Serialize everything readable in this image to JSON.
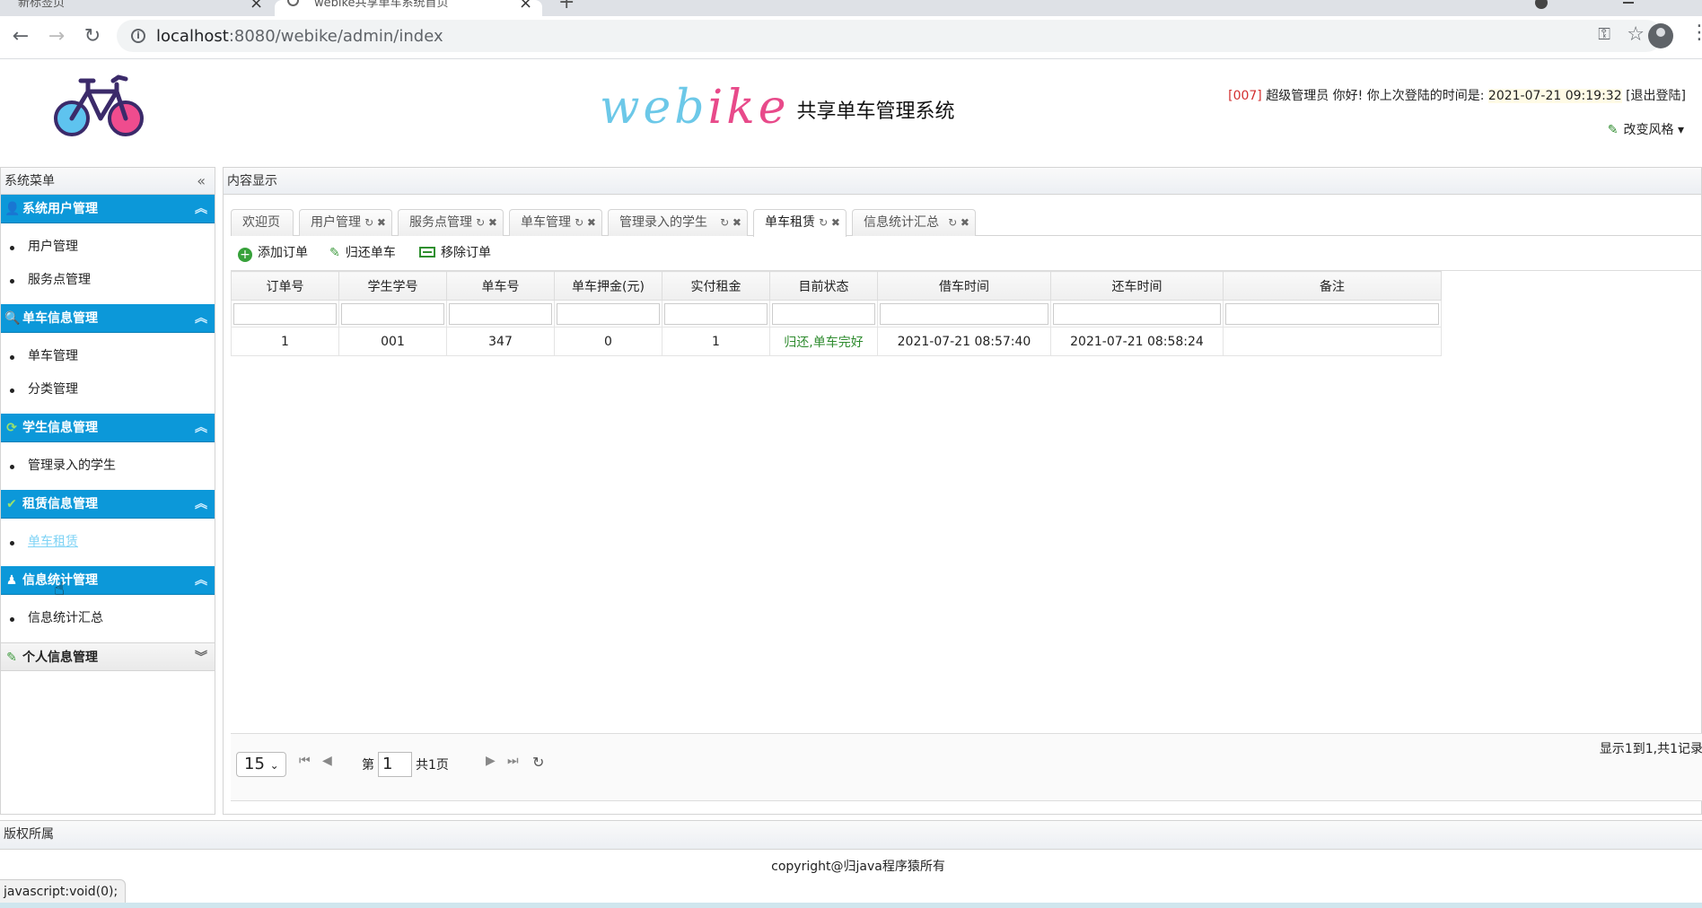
{
  "browser": {
    "tab1_title": "新标签页",
    "tab2_title": "webike共享单车系统首页",
    "url_host": "localhost",
    "url_rest": ":8080/webike/admin/index"
  },
  "header": {
    "brand_web": "web",
    "brand_ike": "ike",
    "brand_sub": "共享单车管理系统",
    "user_code": "[007]",
    "user_greeting": "超级管理员 你好! 你上次登陆的时间是:",
    "last_login": "2021-07-21 09:19:32",
    "logout": "[退出登陆]",
    "change_style": "改变风格"
  },
  "sidebar": {
    "title": "系统菜单",
    "groups": [
      {
        "title": "系统用户管理",
        "items": [
          "用户管理",
          "服务点管理"
        ]
      },
      {
        "title": "单车信息管理",
        "items": [
          "单车管理",
          "分类管理"
        ]
      },
      {
        "title": "学生信息管理",
        "items": [
          "管理录入的学生"
        ]
      },
      {
        "title": "租赁信息管理",
        "items": [
          "单车租赁"
        ]
      },
      {
        "title": "信息统计管理",
        "items": [
          "信息统计汇总"
        ]
      },
      {
        "title": "个人信息管理",
        "items": []
      }
    ]
  },
  "content": {
    "title": "内容显示",
    "tabs": [
      "欢迎页",
      "用户管理",
      "服务点管理",
      "单车管理",
      "管理录入的学生",
      "单车租赁",
      "信息统计汇总"
    ],
    "toolbar": {
      "add": "添加订单",
      "return": "归还单车",
      "remove": "移除订单"
    },
    "columns": [
      "订单号",
      "学生学号",
      "单车号",
      "单车押金(元)",
      "实付租金",
      "目前状态",
      "借车时间",
      "还车时间",
      "备注"
    ],
    "rows": [
      [
        "1",
        "001",
        "347",
        "0",
        "1",
        "归还,单车完好",
        "2021-07-21 08:57:40",
        "2021-07-21 08:58:24",
        ""
      ]
    ]
  },
  "pager": {
    "page_size": "15",
    "page_prefix": "第",
    "page_value": "1",
    "page_total": "共1页",
    "info": "显示1到1,共1记录"
  },
  "footer": {
    "title": "版权所属",
    "copyright": "copyright@归java程序猿所有"
  },
  "status": {
    "link": "javascript:void(0);"
  },
  "colors": {
    "accent": "#0c98d9",
    "ok": "#2e8b2e",
    "brand_cyan": "#6cc8e8",
    "brand_pink": "#e84a8a"
  }
}
